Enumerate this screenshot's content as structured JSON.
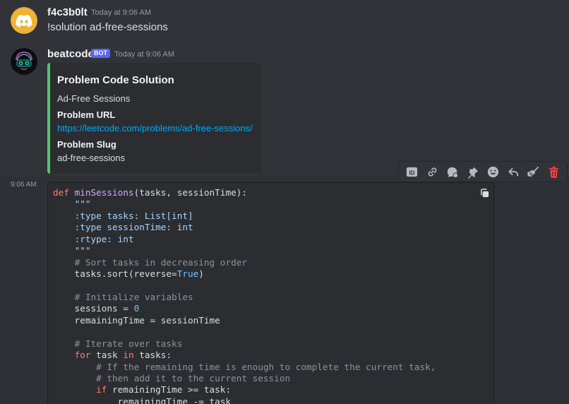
{
  "messages": [
    {
      "username": "f4c3b0lt",
      "timestamp": "Today at 9:06 AM",
      "text": "!solution ad-free-sessions",
      "avatar_icon": "discord-logo-icon"
    },
    {
      "username": "beatcode",
      "badge": "BOT",
      "timestamp": "Today at 9:06 AM",
      "avatar_icon": "bot-avatar-icon",
      "embed": {
        "accent_color": "#57c26a",
        "title": "Problem Code Solution",
        "description": "Ad-Free Sessions",
        "fields": [
          {
            "name": "Problem URL",
            "value": "https://leetcode.com/problems/ad-free-sessions/"
          },
          {
            "name": "Problem Slug",
            "value": "ad-free-sessions"
          }
        ]
      }
    }
  ],
  "code_message": {
    "side_time": "9:06 AM",
    "code": [
      [
        [
          "kw",
          "def "
        ],
        [
          "fn",
          "minSessions"
        ],
        [
          "p",
          "(tasks, sessionTime):"
        ]
      ],
      [
        [
          "p",
          "    "
        ],
        [
          "str",
          "\"\"\""
        ]
      ],
      [
        [
          "p",
          "    "
        ],
        [
          "str",
          ":type tasks: List[int]"
        ]
      ],
      [
        [
          "p",
          "    "
        ],
        [
          "str",
          ":type sessionTime: int"
        ]
      ],
      [
        [
          "p",
          "    "
        ],
        [
          "str",
          ":rtype: int"
        ]
      ],
      [
        [
          "p",
          "    "
        ],
        [
          "str",
          "\"\"\""
        ]
      ],
      [
        [
          "p",
          "    "
        ],
        [
          "cm",
          "# Sort tasks in decreasing order"
        ]
      ],
      [
        [
          "p",
          "    tasks.sort(reverse="
        ],
        [
          "cons",
          "True"
        ],
        [
          "p",
          ")"
        ]
      ],
      [
        [
          "p",
          ""
        ]
      ],
      [
        [
          "p",
          "    "
        ],
        [
          "cm",
          "# Initialize variables"
        ]
      ],
      [
        [
          "p",
          "    sessions = "
        ],
        [
          "num",
          "0"
        ]
      ],
      [
        [
          "p",
          "    remainingTime = sessionTime"
        ]
      ],
      [
        [
          "p",
          ""
        ]
      ],
      [
        [
          "p",
          "    "
        ],
        [
          "cm",
          "# Iterate over tasks"
        ]
      ],
      [
        [
          "p",
          "    "
        ],
        [
          "kw",
          "for"
        ],
        [
          "p",
          " task "
        ],
        [
          "kw",
          "in"
        ],
        [
          "p",
          " tasks:"
        ]
      ],
      [
        [
          "p",
          "        "
        ],
        [
          "cm",
          "# If the remaining time is enough to complete the current task,"
        ]
      ],
      [
        [
          "p",
          "        "
        ],
        [
          "cm",
          "# then add it to the current session"
        ]
      ],
      [
        [
          "p",
          "        "
        ],
        [
          "kw",
          "if"
        ],
        [
          "p",
          " remainingTime >= task:"
        ]
      ],
      [
        [
          "p",
          "            remainingTime -= task"
        ]
      ]
    ]
  },
  "toolbar": [
    {
      "name": "copy-id-button",
      "icon": "id-icon"
    },
    {
      "name": "copy-link-button",
      "icon": "link-icon"
    },
    {
      "name": "create-thread-button",
      "icon": "thread-icon"
    },
    {
      "name": "pin-message-button",
      "icon": "pin-icon"
    },
    {
      "name": "add-reaction-button",
      "icon": "emoji-icon"
    },
    {
      "name": "reply-button",
      "icon": "reply-icon"
    },
    {
      "name": "clean-button",
      "icon": "broom-icon"
    },
    {
      "name": "delete-message-button",
      "icon": "trash-icon",
      "color": "#f23f43"
    }
  ],
  "colors": {
    "background": "#313338",
    "embed_background": "#2b2d31",
    "link": "#00a8fc",
    "bot_badge": "#5865f2",
    "danger": "#f23f43"
  }
}
